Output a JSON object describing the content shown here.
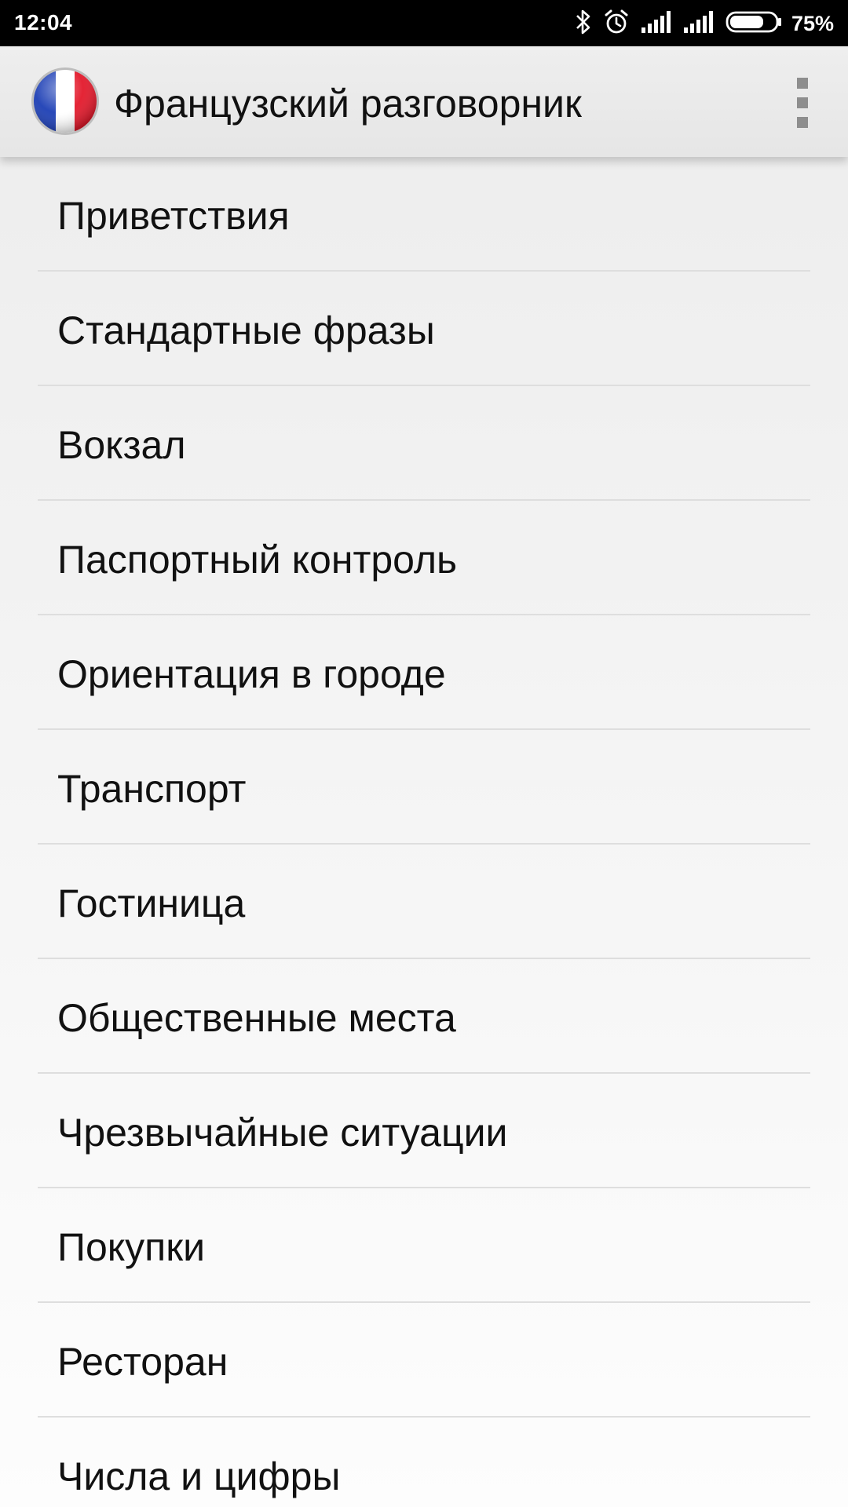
{
  "status_bar": {
    "time": "12:04",
    "battery_percent": "75%",
    "battery_level": 0.75,
    "icons": [
      "bluetooth-icon",
      "alarm-icon",
      "signal-icon",
      "signal-icon",
      "battery-icon"
    ]
  },
  "app_bar": {
    "title": "Французский разговорник",
    "logo_icon": "france-flag-icon",
    "menu_icon": "overflow-menu-icon"
  },
  "topics": [
    {
      "label": "Приветствия"
    },
    {
      "label": "Стандартные фразы"
    },
    {
      "label": "Вокзал"
    },
    {
      "label": "Паспортный контроль"
    },
    {
      "label": "Ориентация в городе"
    },
    {
      "label": "Транспорт"
    },
    {
      "label": "Гостиница"
    },
    {
      "label": "Общественные места"
    },
    {
      "label": "Чрезвычайные ситуации"
    },
    {
      "label": "Покупки"
    },
    {
      "label": "Ресторан"
    },
    {
      "label": "Числа и цифры"
    }
  ],
  "colors": {
    "flag_blue": "#1d3fb5",
    "flag_white": "#ffffff",
    "flag_red": "#e3192b",
    "status_bar_bg": "#000000",
    "text": "#111111"
  }
}
